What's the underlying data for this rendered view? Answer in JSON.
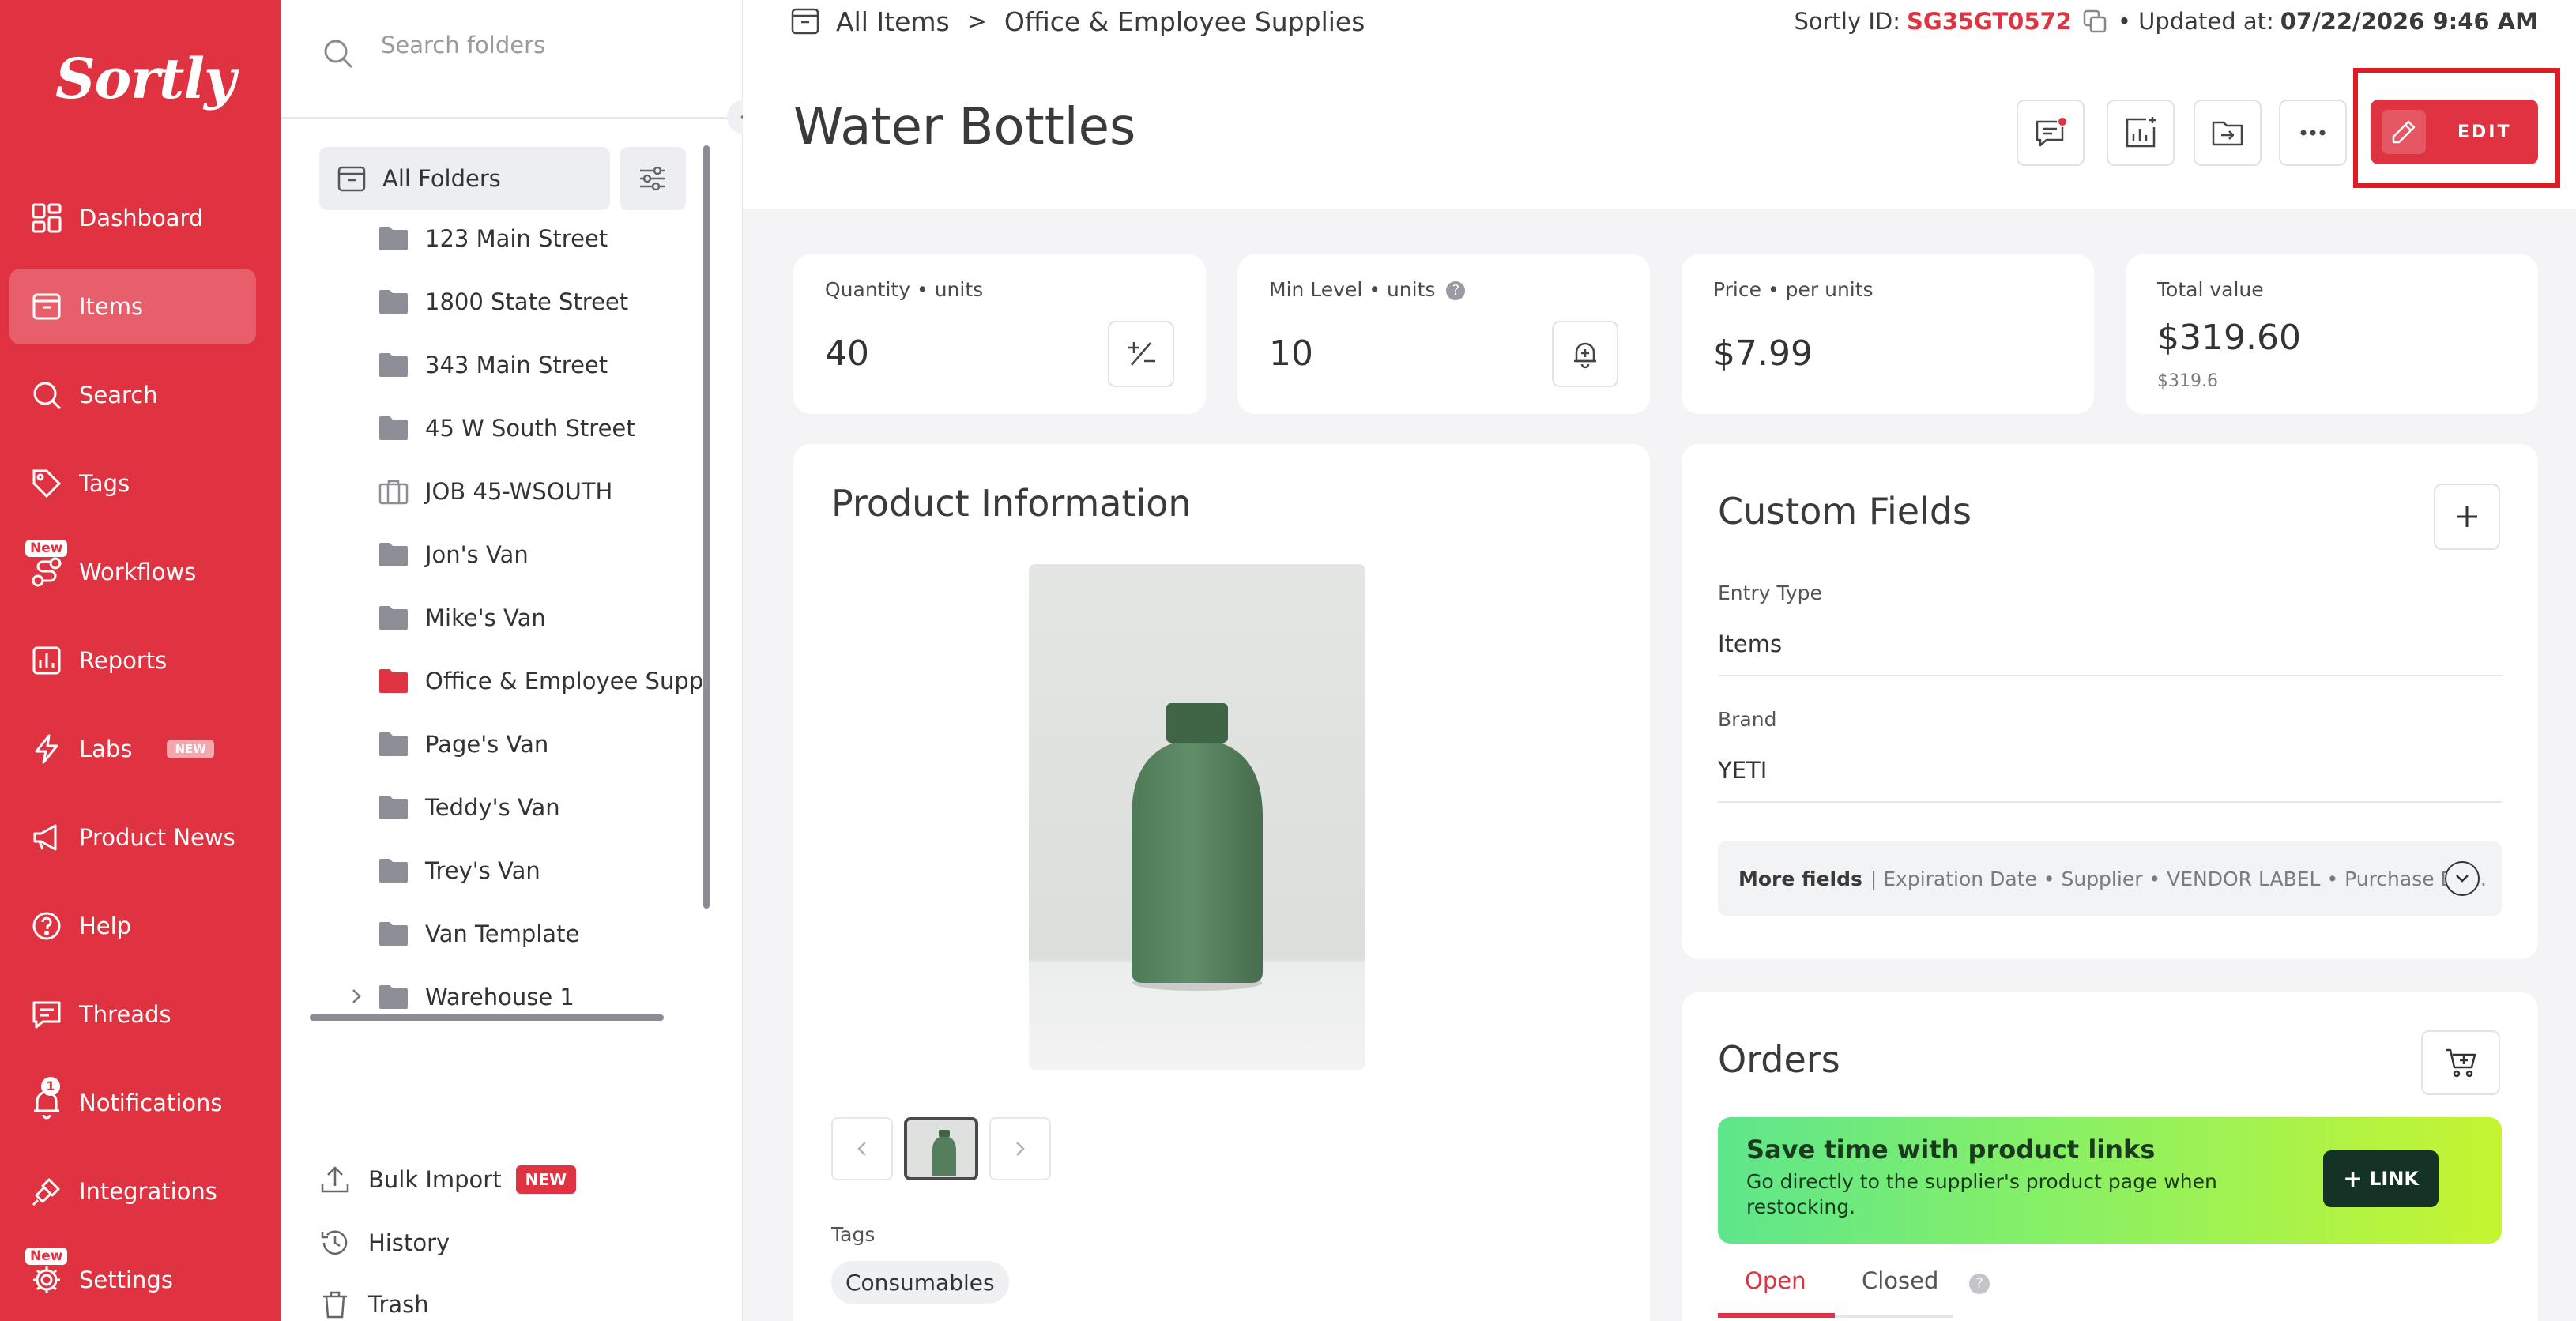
{
  "app": {
    "logo": "Sortly",
    "brand_color": "#df3341"
  },
  "nav": {
    "items": [
      {
        "label": "Dashboard",
        "icon": "dashboard-icon"
      },
      {
        "label": "Items",
        "icon": "items-icon",
        "active": true
      },
      {
        "label": "Search",
        "icon": "search-icon"
      },
      {
        "label": "Tags",
        "icon": "tag-icon"
      },
      {
        "label": "Workflows",
        "icon": "workflows-icon",
        "badge": "New"
      },
      {
        "label": "Reports",
        "icon": "reports-icon"
      },
      {
        "label": "Labs",
        "icon": "lightning-icon",
        "pill": "NEW"
      },
      {
        "label": "Product News",
        "icon": "megaphone-icon"
      },
      {
        "label": "Help",
        "icon": "help-icon"
      },
      {
        "label": "Threads",
        "icon": "threads-icon"
      },
      {
        "label": "Notifications",
        "icon": "bell-icon",
        "count": "1"
      },
      {
        "label": "Integrations",
        "icon": "integrations-icon"
      },
      {
        "label": "Settings",
        "icon": "gear-icon",
        "badge": "New"
      }
    ]
  },
  "folders": {
    "search_placeholder": "Search folders",
    "all_folders": "All Folders",
    "list": [
      {
        "name": "123 Main Street",
        "type": "folder"
      },
      {
        "name": "1800 State Street",
        "type": "folder"
      },
      {
        "name": "343 Main Street",
        "type": "folder"
      },
      {
        "name": "45 W South Street",
        "type": "folder"
      },
      {
        "name": "JOB 45-WSOUTH",
        "type": "job"
      },
      {
        "name": "Jon's Van",
        "type": "folder"
      },
      {
        "name": "Mike's Van",
        "type": "folder"
      },
      {
        "name": "Office & Employee Suppli",
        "type": "folder",
        "active": true
      },
      {
        "name": "Page's Van",
        "type": "folder"
      },
      {
        "name": "Teddy's Van",
        "type": "folder"
      },
      {
        "name": "Trey's Van",
        "type": "folder"
      },
      {
        "name": "Van Template",
        "type": "folder"
      },
      {
        "name": "Warehouse 1",
        "type": "folder",
        "expandable": true
      }
    ],
    "bottom": {
      "bulk_import": "Bulk Import",
      "bulk_import_badge": "NEW",
      "history": "History",
      "trash": "Trash"
    }
  },
  "header": {
    "breadcrumb": {
      "root": "All Items",
      "separator": ">",
      "current": "Office & Employee Supplies"
    },
    "sortly_id_label": "Sortly ID:",
    "sortly_id": "SG35GT0572",
    "updated_label": "• Updated at:",
    "updated_at": "07/22/2026 9:46 AM",
    "title": "Water Bottles",
    "edit_label": "EDIT"
  },
  "stats": {
    "quantity": {
      "label": "Quantity",
      "unit": "units",
      "value": "40"
    },
    "min_level": {
      "label": "Min Level",
      "unit": "units",
      "value": "10"
    },
    "price": {
      "label": "Price",
      "unit": "per units",
      "value": "$7.99"
    },
    "total": {
      "label": "Total value",
      "value": "$319.60",
      "sub": "$319.6"
    }
  },
  "product": {
    "title": "Product Information",
    "tags_label": "Tags",
    "tags": [
      "Consumables"
    ]
  },
  "custom_fields": {
    "title": "Custom Fields",
    "fields": [
      {
        "label": "Entry Type",
        "value": "Items"
      },
      {
        "label": "Brand",
        "value": "YETI"
      }
    ],
    "more_label": "More fields",
    "more_list": "| Expiration Date • Supplier • VENDOR LABEL • Purchase Da..."
  },
  "orders": {
    "title": "Orders",
    "promo_title": "Save time with product links",
    "promo_text": "Go directly to the supplier's product page when restocking.",
    "link_label": "LINK",
    "tabs": [
      "Open",
      "Closed"
    ]
  }
}
